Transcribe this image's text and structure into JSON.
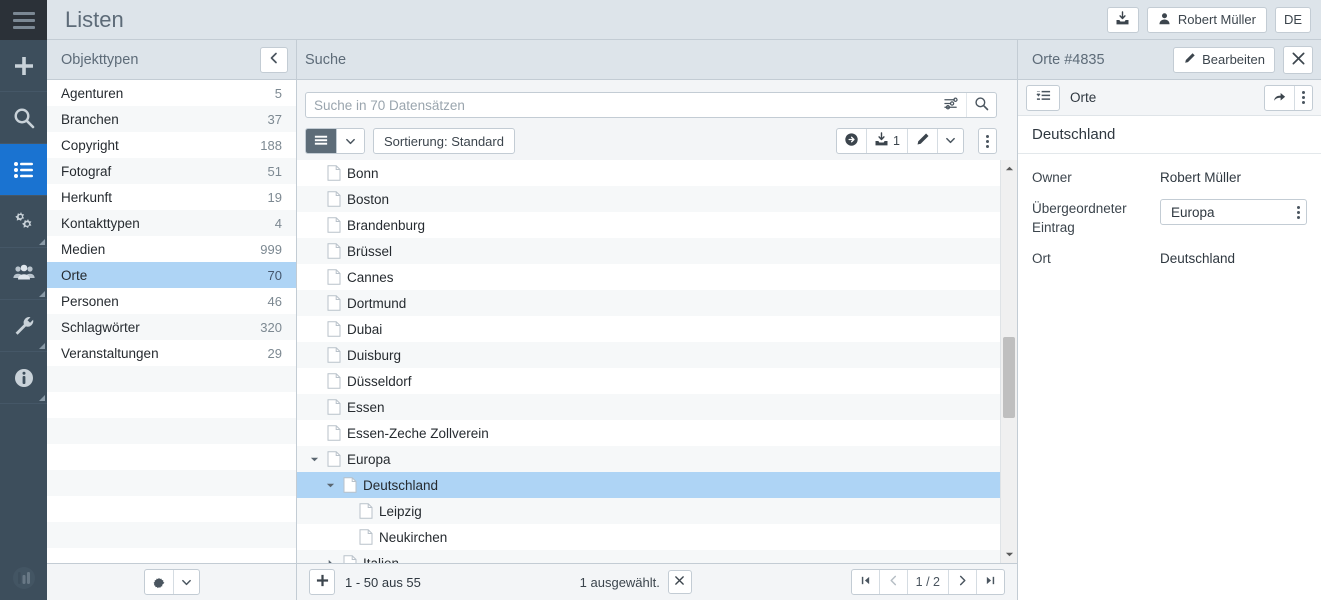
{
  "topbar": {
    "app_title": "Listen",
    "inbox_icon": "download-inbox-icon",
    "user_name": "Robert Müller",
    "language": "DE"
  },
  "rail": {
    "burger_icon": "hamburger-menu-icon",
    "items": [
      {
        "icon": "plus-icon",
        "name": "add",
        "active": false,
        "corner": false
      },
      {
        "icon": "search-icon",
        "name": "search",
        "active": false,
        "corner": false
      },
      {
        "icon": "list-icon",
        "name": "lists",
        "active": true,
        "corner": false
      },
      {
        "icon": "gears-icon",
        "name": "settings",
        "active": false,
        "corner": true
      },
      {
        "icon": "users-icon",
        "name": "users",
        "active": false,
        "corner": true
      },
      {
        "icon": "wrench-icon",
        "name": "tools",
        "active": false,
        "corner": true
      },
      {
        "icon": "info-icon",
        "name": "info",
        "active": false,
        "corner": true
      }
    ],
    "logo_icon": "app-logo-icon"
  },
  "types_panel": {
    "header": "Objekttypen",
    "collapse_icon": "chevron-left-icon",
    "items": [
      {
        "label": "Agenturen",
        "count": "5",
        "selected": false
      },
      {
        "label": "Branchen",
        "count": "37",
        "selected": false
      },
      {
        "label": "Copyright",
        "count": "188",
        "selected": false
      },
      {
        "label": "Fotograf",
        "count": "51",
        "selected": false
      },
      {
        "label": "Herkunft",
        "count": "19",
        "selected": false
      },
      {
        "label": "Kontakttypen",
        "count": "4",
        "selected": false
      },
      {
        "label": "Medien",
        "count": "999",
        "selected": false
      },
      {
        "label": "Orte",
        "count": "70",
        "selected": true
      },
      {
        "label": "Personen",
        "count": "46",
        "selected": false
      },
      {
        "label": "Schlagwörter",
        "count": "320",
        "selected": false
      },
      {
        "label": "Veranstaltungen",
        "count": "29",
        "selected": false
      }
    ],
    "footer": {
      "gear_icon": "gear-icon",
      "chevron_icon": "chevron-down-icon"
    }
  },
  "main_panel": {
    "header": "Suche",
    "search": {
      "placeholder": "Suche in 70 Datensätzen",
      "value": "",
      "filter_icon": "filter-sliders-icon",
      "search_icon": "search-icon"
    },
    "toolbar": {
      "view_icon": "list-view-icon",
      "view_chevron_icon": "chevron-down-icon",
      "sort_label": "Sortierung: Standard",
      "right_buttons": [
        {
          "name": "refresh-arrow-button",
          "icon": "circle-arrow-right-icon",
          "label": ""
        },
        {
          "name": "import-button",
          "icon": "download-inbox-icon",
          "label": "1"
        },
        {
          "name": "edit-button",
          "icon": "pencil-icon",
          "label": ""
        },
        {
          "name": "edit-dropdown-button",
          "icon": "chevron-down-icon",
          "label": ""
        }
      ],
      "overflow_icon": "vertical-dots-icon"
    },
    "rows": [
      {
        "label": "Bonn",
        "depth": 0,
        "twisty": "",
        "selected": false
      },
      {
        "label": "Boston",
        "depth": 0,
        "twisty": "",
        "selected": false
      },
      {
        "label": "Brandenburg",
        "depth": 0,
        "twisty": "",
        "selected": false
      },
      {
        "label": "Brüssel",
        "depth": 0,
        "twisty": "",
        "selected": false
      },
      {
        "label": "Cannes",
        "depth": 0,
        "twisty": "",
        "selected": false
      },
      {
        "label": "Dortmund",
        "depth": 0,
        "twisty": "",
        "selected": false
      },
      {
        "label": "Dubai",
        "depth": 0,
        "twisty": "",
        "selected": false
      },
      {
        "label": "Duisburg",
        "depth": 0,
        "twisty": "",
        "selected": false
      },
      {
        "label": "Düsseldorf",
        "depth": 0,
        "twisty": "",
        "selected": false
      },
      {
        "label": "Essen",
        "depth": 0,
        "twisty": "",
        "selected": false
      },
      {
        "label": "Essen-Zeche Zollverein",
        "depth": 0,
        "twisty": "",
        "selected": false
      },
      {
        "label": "Europa",
        "depth": 0,
        "twisty": "expanded",
        "selected": false
      },
      {
        "label": "Deutschland",
        "depth": 1,
        "twisty": "expanded",
        "selected": true
      },
      {
        "label": "Leipzig",
        "depth": 2,
        "twisty": "",
        "selected": false
      },
      {
        "label": "Neukirchen",
        "depth": 2,
        "twisty": "",
        "selected": false
      },
      {
        "label": "Italien",
        "depth": 1,
        "twisty": "collapsed",
        "selected": false
      }
    ],
    "footer": {
      "add_icon": "plus-icon",
      "range": "1 - 50 aus 55",
      "selection": "1 ausgewählt.",
      "clear_selection_icon": "close-x-icon",
      "pager": {
        "first_icon": "first-page-icon",
        "prev_icon": "chevron-left-icon",
        "page": "1 / 2",
        "next_icon": "chevron-right-icon",
        "last_icon": "last-page-icon"
      }
    }
  },
  "detail_panel": {
    "header": "Orte #4835",
    "edit_label": "Bearbeiten",
    "edit_icon": "pencil-icon",
    "close_icon": "close-x-icon",
    "sub": {
      "form_icon": "form-list-icon",
      "name": "Orte",
      "share_icon": "share-arrow-icon",
      "overflow_icon": "vertical-dots-icon"
    },
    "record_title": "Deutschland",
    "fields": [
      {
        "key": "Owner",
        "value": "Robert Müller",
        "type": "text"
      },
      {
        "key": "Übergeordneter Eintrag",
        "value": "Europa",
        "type": "chip"
      },
      {
        "key": "Ort",
        "value": "Deutschland",
        "type": "text"
      }
    ]
  },
  "colors": {
    "rail_bg": "#3d4e5c",
    "rail_active": "#1a73d1",
    "header_bg": "#dde4ea",
    "selection_blue": "#aed4f5",
    "panel_bg": "#f3f5f7"
  }
}
